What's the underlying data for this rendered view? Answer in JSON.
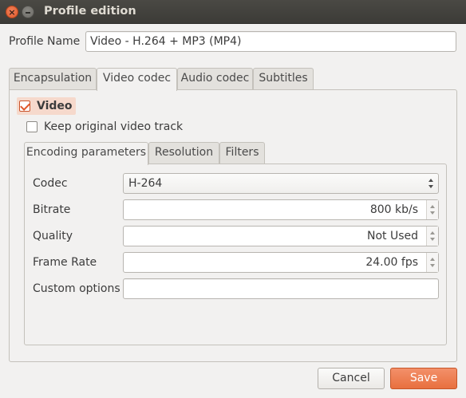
{
  "window": {
    "title": "Profile edition"
  },
  "profile": {
    "label": "Profile Name",
    "value": "Video - H.264 + MP3 (MP4)"
  },
  "tabs": [
    {
      "label": "Encapsulation",
      "active": false
    },
    {
      "label": "Video codec",
      "active": true
    },
    {
      "label": "Audio codec",
      "active": false
    },
    {
      "label": "Subtitles",
      "active": false
    }
  ],
  "video": {
    "enable_label": "Video",
    "enabled": true,
    "keep_original_label": "Keep original video track",
    "keep_original": false
  },
  "subtabs": [
    {
      "label": "Encoding parameters",
      "active": true
    },
    {
      "label": "Resolution",
      "active": false
    },
    {
      "label": "Filters",
      "active": false
    }
  ],
  "encoding": {
    "codec": {
      "label": "Codec",
      "value": "H-264"
    },
    "bitrate": {
      "label": "Bitrate",
      "value": "800 kb/s"
    },
    "quality": {
      "label": "Quality",
      "value": "Not Used"
    },
    "frame_rate": {
      "label": "Frame Rate",
      "value": "24.00 fps"
    },
    "custom_options": {
      "label": "Custom options",
      "value": ""
    }
  },
  "buttons": {
    "cancel": "Cancel",
    "save": "Save"
  },
  "colors": {
    "accent": "#e8703f",
    "titlebar": "#3c3b37",
    "background": "#f2f1f0"
  }
}
